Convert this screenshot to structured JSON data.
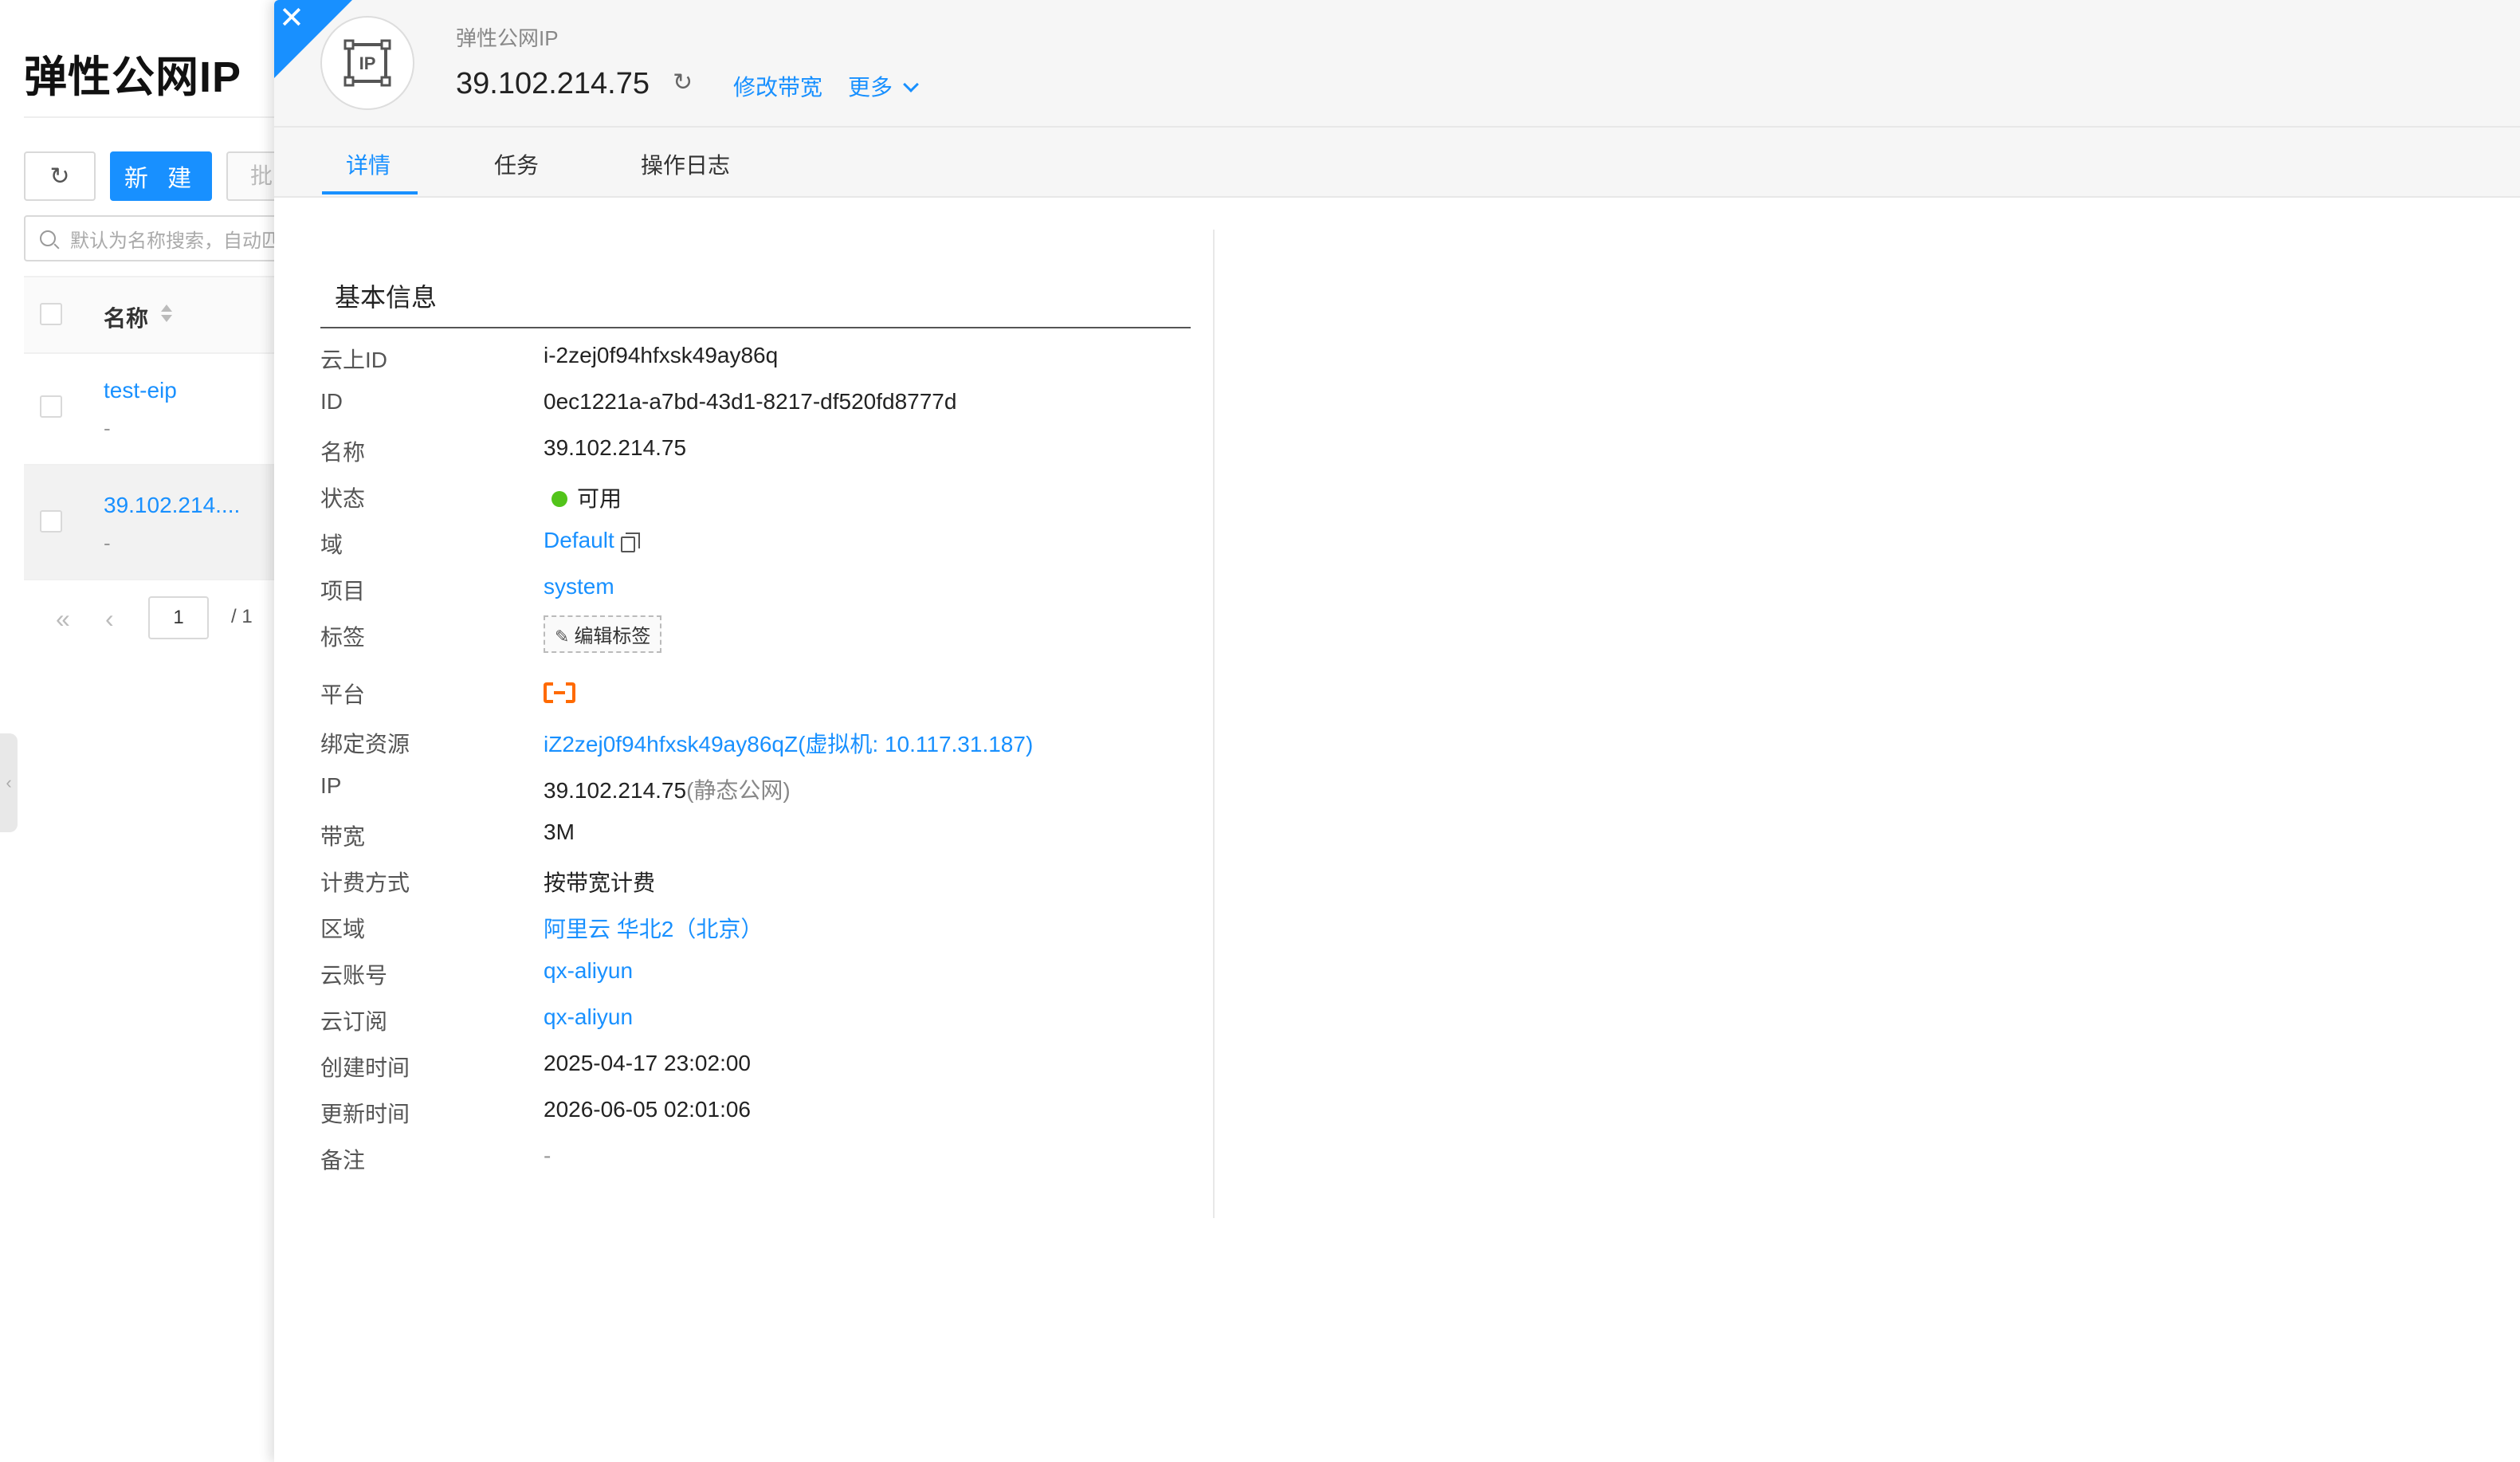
{
  "bg": {
    "title": "弹性公网IP",
    "new_btn": "新 建",
    "batch_btn": "批",
    "search_placeholder": "默认为名称搜索，自动匹",
    "col_name": "名称",
    "rows": [
      {
        "name": "test-eip",
        "sub": "-"
      },
      {
        "name": "39.102.214....",
        "sub": "-"
      }
    ],
    "pager": {
      "page": "1",
      "total": "/ 1"
    }
  },
  "drawer": {
    "subtitle": "弹性公网IP",
    "title": "39.102.214.75",
    "actions": {
      "modify_bandwidth": "修改带宽",
      "more": "更多"
    },
    "tabs": [
      "详情",
      "任务",
      "操作日志"
    ],
    "section_title": "基本信息",
    "fields": {
      "cloud_id": {
        "label": "云上ID",
        "value": "i-2zej0f94hfxsk49ay86q"
      },
      "id": {
        "label": "ID",
        "value": "0ec1221a-a7bd-43d1-8217-df520fd8777d"
      },
      "name": {
        "label": "名称",
        "value": "39.102.214.75"
      },
      "status": {
        "label": "状态",
        "value": "可用"
      },
      "domain": {
        "label": "域",
        "value": "Default"
      },
      "project": {
        "label": "项目",
        "value": "system"
      },
      "tags": {
        "label": "标签",
        "value": "编辑标签"
      },
      "platform": {
        "label": "平台",
        "value": "aliyun-logo"
      },
      "bound": {
        "label": "绑定资源",
        "value": "iZ2zej0f94hfxsk49ay86qZ(虚拟机: 10.117.31.187)"
      },
      "ip": {
        "label": "IP",
        "value": "39.102.214.75",
        "suffix": "(静态公网)"
      },
      "bandwidth": {
        "label": "带宽",
        "value": "3M"
      },
      "billing": {
        "label": "计费方式",
        "value": "按带宽计费"
      },
      "region": {
        "label": "区域",
        "value": "阿里云 华北2（北京）"
      },
      "account": {
        "label": "云账号",
        "value": "qx-aliyun"
      },
      "subscription": {
        "label": "云订阅",
        "value": "qx-aliyun"
      },
      "created": {
        "label": "创建时间",
        "value": "2025-04-17 23:02:00"
      },
      "updated": {
        "label": "更新时间",
        "value": "2026-06-05 02:01:06"
      },
      "remark": {
        "label": "备注",
        "value": "-"
      }
    }
  },
  "colors": {
    "accent": "#1890ff",
    "status_ok": "#52c41a",
    "aliyun": "#ff6a00"
  }
}
